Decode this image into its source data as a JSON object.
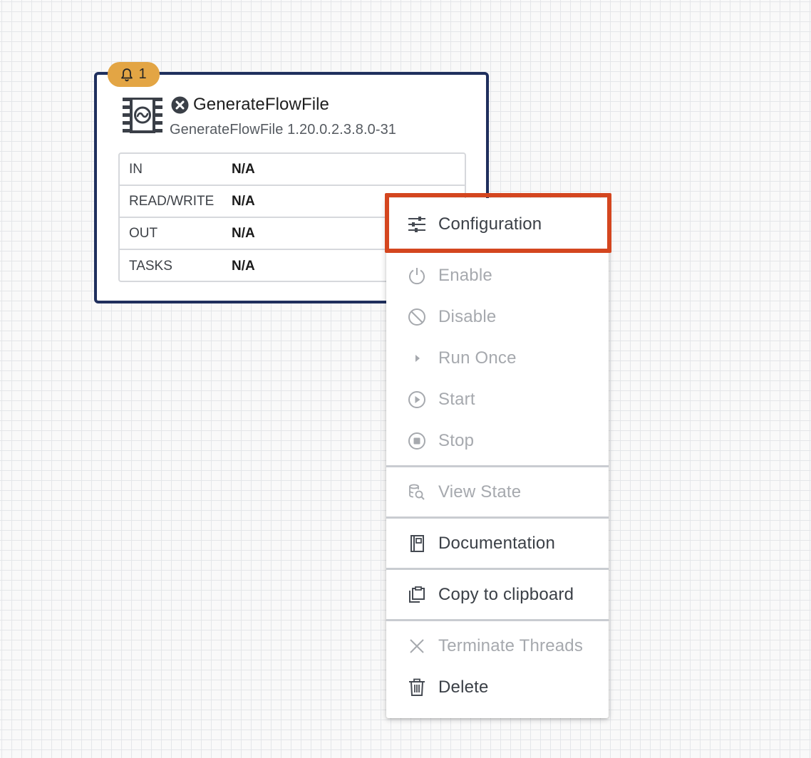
{
  "processor": {
    "name": "GenerateFlowFile",
    "type_version": "GenerateFlowFile 1.20.0.2.3.8.0-31",
    "bulletin_count": "1",
    "stats": [
      {
        "label": "IN",
        "value": "N/A"
      },
      {
        "label": "READ/WRITE",
        "value": "N/A"
      },
      {
        "label": "OUT",
        "value": "N/A"
      },
      {
        "label": "TASKS",
        "value": "N/A"
      }
    ],
    "status_icon": "invalid-x-icon",
    "type_icon": "processor-icon"
  },
  "context_menu": {
    "items": [
      {
        "label": "Configuration",
        "icon": "configuration-sliders-icon",
        "enabled": true
      },
      {
        "label": "Enable",
        "icon": "power-icon",
        "enabled": false
      },
      {
        "label": "Disable",
        "icon": "disable-circle-slash-icon",
        "enabled": false
      },
      {
        "label": "Run Once",
        "icon": "caret-right-icon",
        "enabled": false
      },
      {
        "label": "Start",
        "icon": "play-circle-icon",
        "enabled": false
      },
      {
        "label": "Stop",
        "icon": "stop-circle-icon",
        "enabled": false
      },
      {
        "label": "View State",
        "icon": "view-state-icon",
        "enabled": false
      },
      {
        "label": "Documentation",
        "icon": "documentation-book-icon",
        "enabled": true
      },
      {
        "label": "Copy to clipboard",
        "icon": "clipboard-copy-icon",
        "enabled": true
      },
      {
        "label": "Terminate Threads",
        "icon": "close-x-icon",
        "enabled": false
      },
      {
        "label": "Delete",
        "icon": "trash-icon",
        "enabled": true
      }
    ],
    "highlighted_item": "Configuration"
  },
  "colors": {
    "processor_border": "#1f2f5d",
    "bulletin_badge": "#e3a544",
    "highlight_outline": "#d4461f",
    "enabled_text": "#3b4047",
    "disabled_text": "#a6a9ae"
  }
}
